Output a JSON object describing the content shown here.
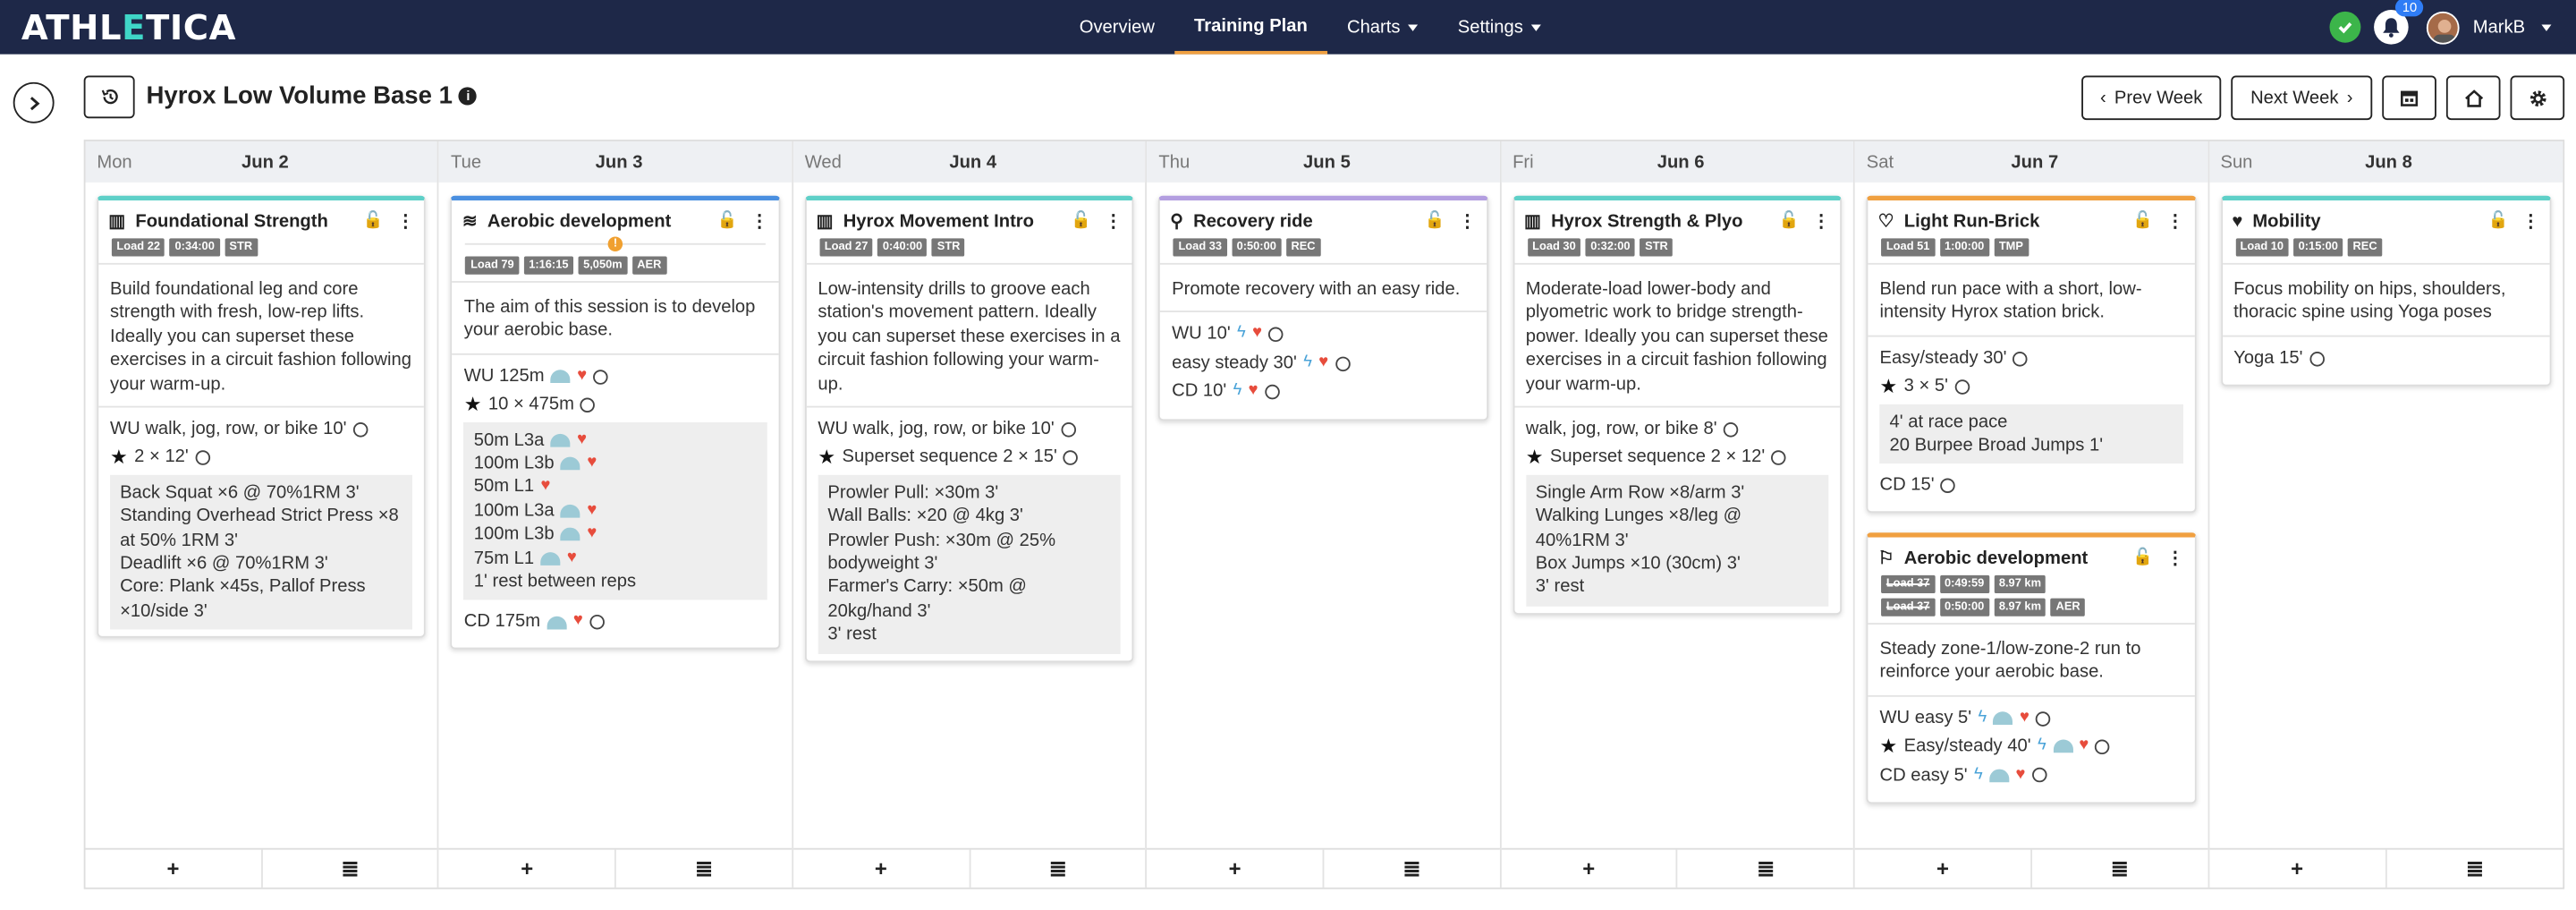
{
  "app": {
    "logo": "ATHLETICA",
    "logo_a": "ATHL",
    "logo_b": "E",
    "logo_c": "TICA"
  },
  "nav": {
    "overview": "Overview",
    "training_plan": "Training Plan",
    "charts": "Charts",
    "settings": "Settings"
  },
  "notifications": {
    "count": "10"
  },
  "user": {
    "name": "MarkB"
  },
  "page": {
    "title": "Hyrox Low Volume Base 1"
  },
  "toolbar": {
    "prev_week": "Prev Week",
    "next_week": "Next Week"
  },
  "days": [
    {
      "dow": "Mon",
      "date": "Jun 2"
    },
    {
      "dow": "Tue",
      "date": "Jun 3"
    },
    {
      "dow": "Wed",
      "date": "Jun 4"
    },
    {
      "dow": "Thu",
      "date": "Jun 5"
    },
    {
      "dow": "Fri",
      "date": "Jun 6"
    },
    {
      "dow": "Sat",
      "date": "Jun 7"
    },
    {
      "dow": "Sun",
      "date": "Jun 8"
    }
  ],
  "footer": {
    "add": "+",
    "stack": "≣"
  },
  "colors": {
    "str": "#5ed0c8",
    "aer": "#4a8fe0",
    "rec": "#b39ee0",
    "tmp": "#f0a040",
    "nav_bg": "#1e2848"
  },
  "workouts": {
    "mon": {
      "title": "Foundational Strength",
      "tags": [
        "Load 22",
        "0:34:00",
        "STR"
      ],
      "desc": "Build foundational leg and core strength with fresh, low-rep lifts. Ideally you can superset these exercises in a circuit fashion following your warm-up.",
      "s1": "WU walk, jog, row, or bike 10'",
      "s2": "2 × 12'",
      "box": [
        "Back Squat ×6 @ 70%1RM 3'",
        "Standing Overhead Strict Press ×8 at 50% 1RM 3'",
        "Deadlift ×6 @ 70%1RM 3'",
        "Core: Plank ×45s, Pallof Press ×10/side 3'"
      ]
    },
    "tue": {
      "title": "Aerobic development",
      "tags": [
        "Load 79",
        "1:16:15",
        "5,050m",
        "AER"
      ],
      "warn": "!",
      "desc": "The aim of this session is to develop your aerobic base.",
      "s1": "WU 125m",
      "s2": "10 × 475m",
      "box": [
        "50m L3a",
        "100m L3b",
        "50m L1",
        "100m L3a",
        "100m L3b",
        "75m L1",
        "1' rest between reps"
      ],
      "s3": "CD 175m"
    },
    "wed": {
      "title": "Hyrox Movement Intro",
      "tags": [
        "Load 27",
        "0:40:00",
        "STR"
      ],
      "desc": "Low-intensity drills to groove each station's movement pattern. Ideally you can superset these exercises in a circuit fashion following your warm-up.",
      "s1": "WU walk, jog, row, or bike 10'",
      "s2": "Superset sequence 2 × 15'",
      "box": [
        "Prowler Pull: ×30m 3'",
        "Wall Balls: ×20 @ 4kg 3'",
        "Prowler Push: ×30m @ 25% bodyweight 3'",
        "Farmer's Carry: ×50m @ 20kg/hand 3'",
        "3' rest"
      ]
    },
    "thu": {
      "title": "Recovery ride",
      "tags": [
        "Load 33",
        "0:50:00",
        "REC"
      ],
      "desc": "Promote recovery with an easy ride.",
      "s1": "WU 10'",
      "s2": "easy steady 30'",
      "s3": "CD 10'"
    },
    "fri": {
      "title": "Hyrox Strength & Plyo",
      "tags": [
        "Load 30",
        "0:32:00",
        "STR"
      ],
      "desc": "Moderate-load lower-body and plyometric work to bridge strength-power. Ideally you can superset these exercises in a circuit fashion following your warm-up.",
      "s1": "walk, jog, row, or bike 8'",
      "s2": "Superset sequence 2 × 12'",
      "box": [
        "Single Arm Row ×8/arm 3'",
        "Walking Lunges ×8/leg @ 40%1RM 3'",
        "Box Jumps ×10 (30cm) 3'",
        "3' rest"
      ]
    },
    "sat1": {
      "title": "Light Run-Brick",
      "tags": [
        "Load 51",
        "1:00:00",
        "TMP"
      ],
      "desc": "Blend run pace with a short, low-intensity Hyrox station brick.",
      "s1": "Easy/steady 30'",
      "s2": "3 × 5'",
      "box": [
        "4' at race pace",
        "20 Burpee Broad Jumps 1'"
      ],
      "s3": "CD 15'"
    },
    "sat2": {
      "title": "Aerobic development",
      "tags_old": [
        "Load 37",
        "0:49:59",
        "8.97 km"
      ],
      "tags": [
        "Load 37",
        "0:50:00",
        "8.97 km",
        "AER"
      ],
      "desc": "Steady zone-1/low-zone-2 run to reinforce your aerobic base.",
      "s1": "WU easy 5'",
      "s2": "Easy/steady 40'",
      "s3": "CD easy 5'"
    },
    "sun": {
      "title": "Mobility",
      "tags": [
        "Load 10",
        "0:15:00",
        "REC"
      ],
      "desc": "Focus mobility on hips, shoulders, thoracic spine using Yoga poses",
      "s1": "Yoga 15'"
    }
  }
}
